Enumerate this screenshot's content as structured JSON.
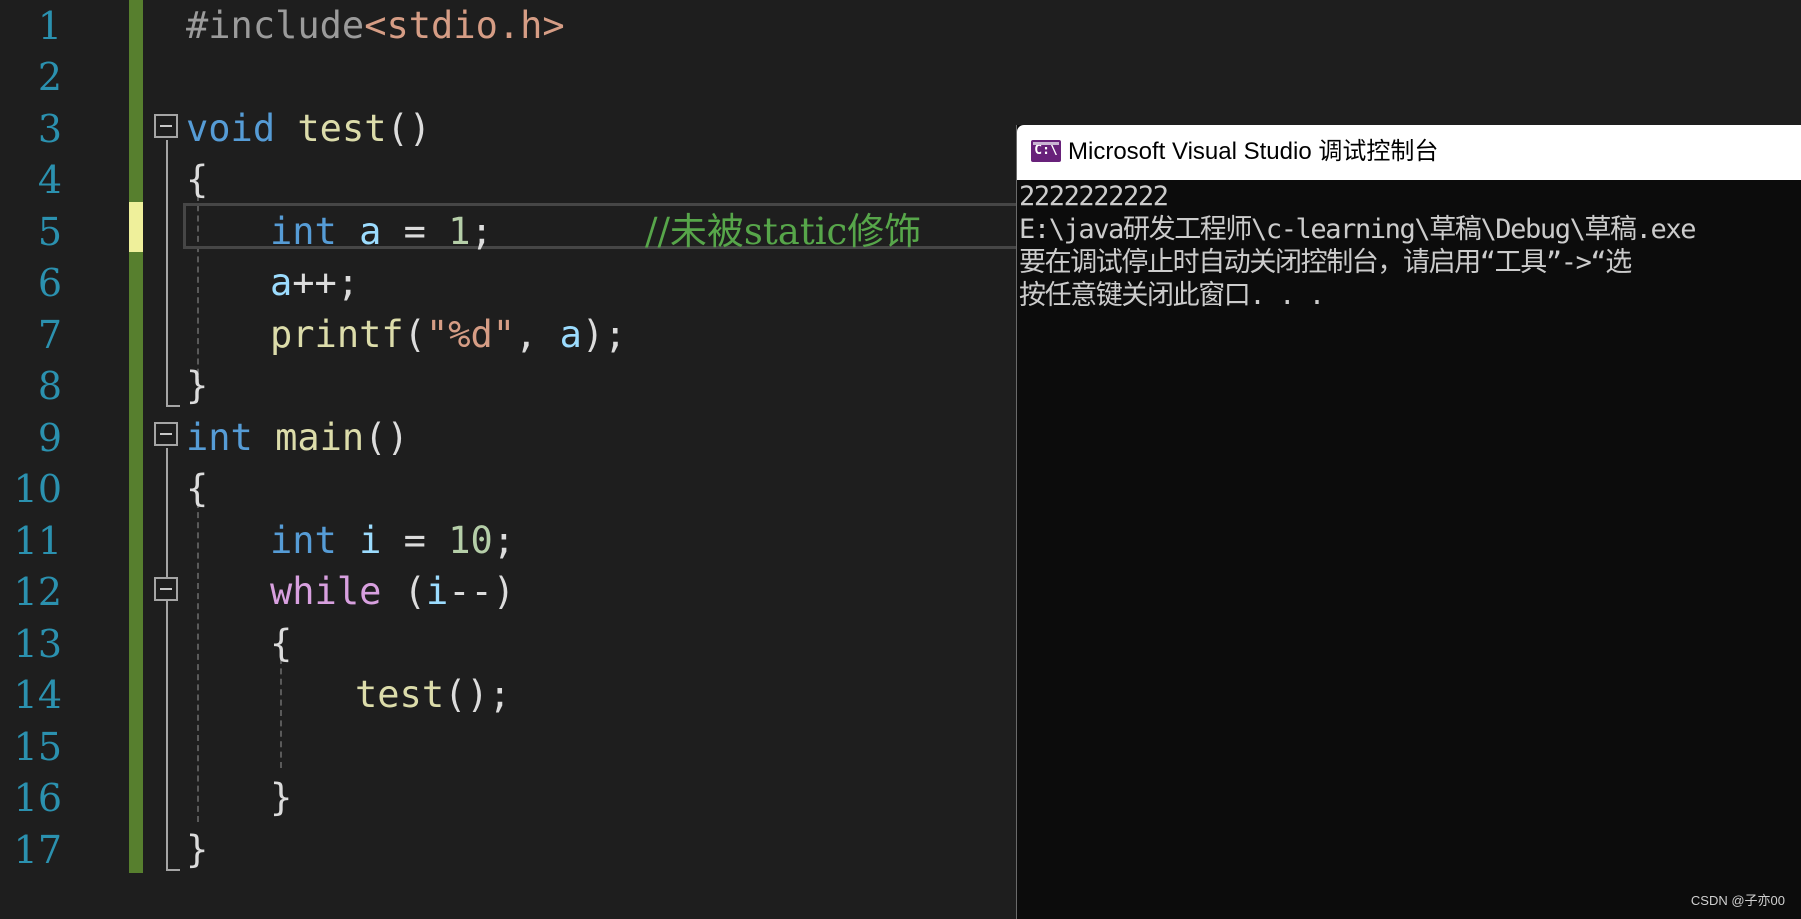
{
  "editor": {
    "line_numbers": [
      "1",
      "2",
      "3",
      "4",
      "5",
      "6",
      "7",
      "8",
      "9",
      "10",
      "11",
      "12",
      "13",
      "14",
      "15",
      "16",
      "17"
    ],
    "code": {
      "l1": {
        "directive": "#include",
        "header": "<stdio.h>"
      },
      "l3": {
        "type": "void",
        "name": "test",
        "paren": "()"
      },
      "l4": {
        "brace": "{"
      },
      "l5": {
        "type": "int",
        "var": "a",
        "op": " = ",
        "num": "1",
        "semi": ";",
        "comment": "//未被static修饰"
      },
      "l6": {
        "expr": "a",
        "rest": "++;"
      },
      "l7": {
        "fn": "printf",
        "open": "(",
        "fmt": "\"%d\"",
        "sep": ", ",
        "var": "a",
        "close": ");"
      },
      "l8": {
        "brace": "}"
      },
      "l9": {
        "type": "int",
        "name": "main",
        "paren": "()"
      },
      "l10": {
        "brace": "{"
      },
      "l11": {
        "type": "int",
        "var": "i",
        "op": " = ",
        "num": "10",
        "semi": ";"
      },
      "l12": {
        "kw": "while",
        "open": " (",
        "var": "i",
        "rest": "--)"
      },
      "l13": {
        "brace": "{"
      },
      "l14": {
        "fn": "test",
        "rest": "();"
      },
      "l16": {
        "brace": "}"
      },
      "l17": {
        "brace": "}"
      }
    }
  },
  "console": {
    "title": "Microsoft Visual Studio 调试控制台",
    "icon": "c-console-icon",
    "icon_text": "C:\\",
    "lines": [
      "2222222222",
      "E:\\java研发工程师\\c-learning\\草稿\\Debug\\草稿.exe",
      "要在调试停止时自动关闭控制台，请启用“工具”->“选",
      "按任意键关闭此窗口. . ."
    ]
  },
  "watermark": "CSDN @子亦00"
}
